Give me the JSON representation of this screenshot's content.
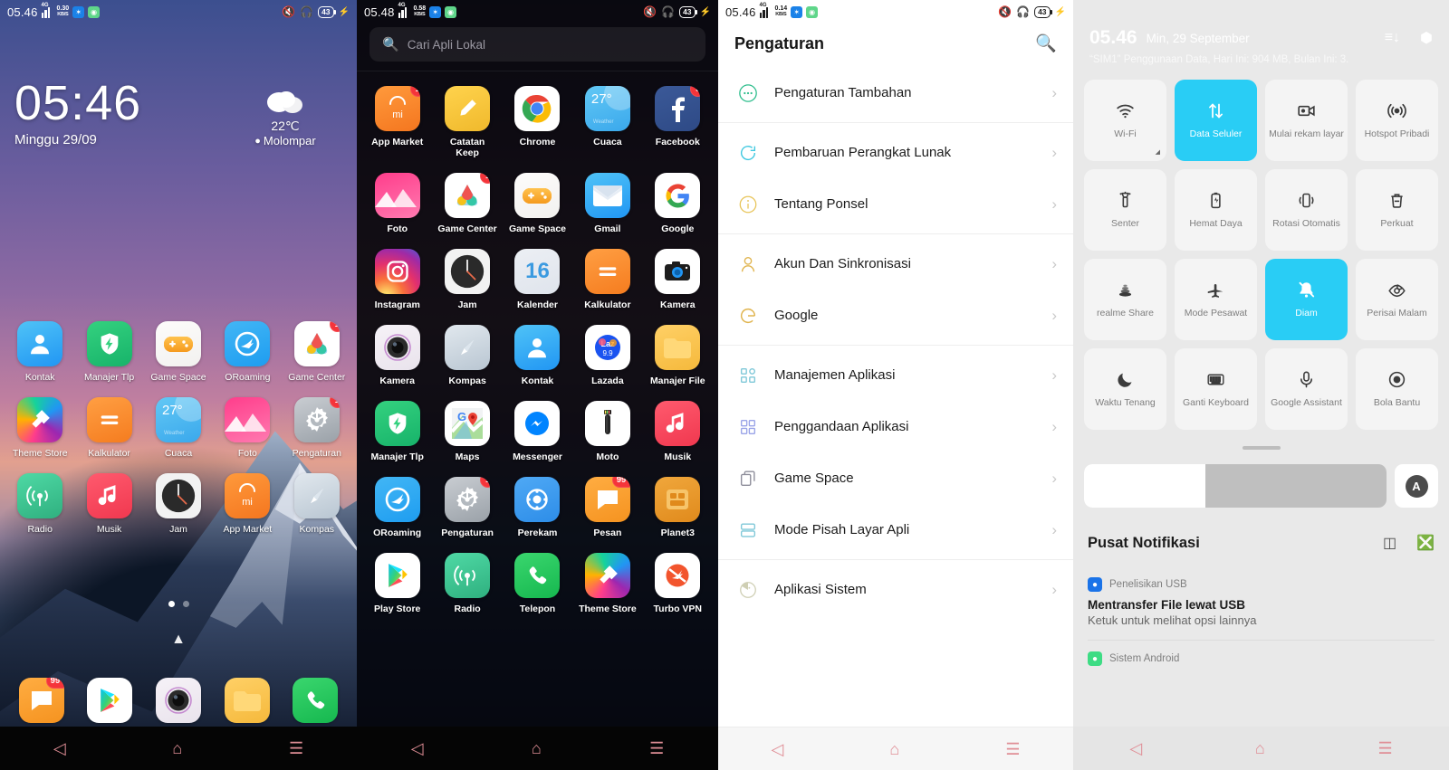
{
  "status_bar": {
    "home": {
      "time": "05.46",
      "net": "4G",
      "speed": "0.30",
      "speed_unit": "KB/S",
      "battery": "43"
    },
    "drawer": {
      "time": "05.48",
      "net": "4G",
      "speed": "0.58",
      "speed_unit": "KB/S",
      "battery": "43"
    },
    "settings": {
      "time": "05.46",
      "net": "4G",
      "speed": "0.14",
      "speed_unit": "KB/S",
      "battery": "43"
    }
  },
  "home": {
    "clock": "05:46",
    "date": "Minggu 29/09",
    "weather": {
      "temp": "22℃",
      "location": "Molompar",
      "pin": "📍"
    },
    "apps": [
      {
        "label": "Kontak",
        "icon": "contacts-icon",
        "badge": ""
      },
      {
        "label": "Manajer Tlp",
        "icon": "phone-manager-icon",
        "badge": ""
      },
      {
        "label": "Game Space",
        "icon": "game-space-icon",
        "badge": ""
      },
      {
        "label": "ORoaming",
        "icon": "oroaming-icon",
        "badge": ""
      },
      {
        "label": "Game Center",
        "icon": "game-center-icon",
        "badge": "1"
      },
      {
        "label": "Theme Store",
        "icon": "theme-store-icon",
        "badge": ""
      },
      {
        "label": "Kalkulator",
        "icon": "calculator-icon",
        "badge": ""
      },
      {
        "label": "Cuaca",
        "icon": "weather-icon",
        "badge": ""
      },
      {
        "label": "Foto",
        "icon": "photos-icon",
        "badge": ""
      },
      {
        "label": "Pengaturan",
        "icon": "settings-icon",
        "badge": "1"
      },
      {
        "label": "Radio",
        "icon": "radio-icon",
        "badge": ""
      },
      {
        "label": "Musik",
        "icon": "music-icon",
        "badge": ""
      },
      {
        "label": "Jam",
        "icon": "clock-icon",
        "badge": ""
      },
      {
        "label": "App Market",
        "icon": "app-market-icon",
        "badge": ""
      },
      {
        "label": "Kompas",
        "icon": "compass-icon",
        "badge": ""
      }
    ],
    "weather_tile_temp": "27°",
    "page_dots": {
      "count": 2,
      "active": 0
    },
    "dock": [
      {
        "label": "Pesan",
        "icon": "messages-icon",
        "badge": "99+"
      },
      {
        "label": "Play Store",
        "icon": "play-store-icon",
        "badge": ""
      },
      {
        "label": "Kamera",
        "icon": "camera-icon",
        "badge": ""
      },
      {
        "label": "Manajer File",
        "icon": "file-manager-icon",
        "badge": ""
      },
      {
        "label": "Telepon",
        "icon": "phone-icon",
        "badge": ""
      }
    ]
  },
  "drawer": {
    "search_placeholder": "Cari Apli Lokal",
    "apps": [
      {
        "label": "App Market",
        "icon": "app-market-icon",
        "badge": "1"
      },
      {
        "label": "Catatan Keep",
        "icon": "keep-notes-icon",
        "badge": ""
      },
      {
        "label": "Chrome",
        "icon": "chrome-icon",
        "badge": ""
      },
      {
        "label": "Cuaca",
        "icon": "weather-icon",
        "badge": ""
      },
      {
        "label": "Facebook",
        "icon": "facebook-icon",
        "badge": "5"
      },
      {
        "label": "Foto",
        "icon": "photos-icon",
        "badge": ""
      },
      {
        "label": "Game Center",
        "icon": "game-center-icon",
        "badge": "1"
      },
      {
        "label": "Game Space",
        "icon": "game-space-icon",
        "badge": ""
      },
      {
        "label": "Gmail",
        "icon": "gmail-icon",
        "badge": ""
      },
      {
        "label": "Google",
        "icon": "google-icon",
        "badge": ""
      },
      {
        "label": "Instagram",
        "icon": "instagram-icon",
        "badge": ""
      },
      {
        "label": "Jam",
        "icon": "clock-icon",
        "badge": ""
      },
      {
        "label": "Kalender",
        "icon": "calendar-icon",
        "badge": ""
      },
      {
        "label": "Kalkulator",
        "icon": "calculator-icon",
        "badge": ""
      },
      {
        "label": "Kamera",
        "icon": "camera-stock-icon",
        "badge": ""
      },
      {
        "label": "Kamera",
        "icon": "camera-icon",
        "badge": ""
      },
      {
        "label": "Kompas",
        "icon": "compass-icon",
        "badge": ""
      },
      {
        "label": "Kontak",
        "icon": "contacts-icon",
        "badge": ""
      },
      {
        "label": "Lazada",
        "icon": "lazada-icon",
        "badge": ""
      },
      {
        "label": "Manajer File",
        "icon": "file-manager-icon",
        "badge": ""
      },
      {
        "label": "Manajer Tlp",
        "icon": "phone-manager-icon",
        "badge": ""
      },
      {
        "label": "Maps",
        "icon": "maps-icon",
        "badge": ""
      },
      {
        "label": "Messenger",
        "icon": "messenger-icon",
        "badge": ""
      },
      {
        "label": "Moto",
        "icon": "moto-icon",
        "badge": ""
      },
      {
        "label": "Musik",
        "icon": "music-icon",
        "badge": ""
      },
      {
        "label": "ORoaming",
        "icon": "oroaming-icon",
        "badge": ""
      },
      {
        "label": "Pengaturan",
        "icon": "settings-icon",
        "badge": "1"
      },
      {
        "label": "Perekam",
        "icon": "recorder-icon",
        "badge": ""
      },
      {
        "label": "Pesan",
        "icon": "messages-icon",
        "badge": "99+"
      },
      {
        "label": "Planet3",
        "icon": "planet3-icon",
        "badge": ""
      },
      {
        "label": "Play Store",
        "icon": "play-store-icon",
        "badge": ""
      },
      {
        "label": "Radio",
        "icon": "radio-icon",
        "badge": ""
      },
      {
        "label": "Telepon",
        "icon": "phone-icon",
        "badge": ""
      },
      {
        "label": "Theme Store",
        "icon": "theme-store-icon",
        "badge": ""
      },
      {
        "label": "Turbo VPN",
        "icon": "turbo-vpn-icon",
        "badge": ""
      }
    ],
    "calendar_day": "16",
    "lazada_sale": "9.9",
    "weather_tile_temp": "27°"
  },
  "settings": {
    "title": "Pengaturan",
    "search_icon": "search-icon",
    "groups": [
      {
        "rows": [
          {
            "label": "Pengaturan Tambahan",
            "icon": "more-dots-icon",
            "color": "#2dbd8c"
          }
        ]
      },
      {
        "rows": [
          {
            "label": "Pembaruan Perangkat Lunak",
            "icon": "refresh-icon",
            "color": "#3ec8e0"
          },
          {
            "label": "Tentang Ponsel",
            "icon": "info-icon",
            "color": "#e8c55a"
          }
        ]
      },
      {
        "rows": [
          {
            "label": "Akun Dan Sinkronisasi",
            "icon": "person-icon",
            "color": "#e0b44e"
          },
          {
            "label": "Google",
            "icon": "google-g-icon",
            "color": "#e0b44e"
          }
        ]
      },
      {
        "rows": [
          {
            "label": "Manajemen Aplikasi",
            "icon": "app-grid-icon",
            "color": "#7fc8d8"
          },
          {
            "label": "Penggandaan Aplikasi",
            "icon": "clone-apps-icon",
            "color": "#9aa4e8"
          },
          {
            "label": "Game Space",
            "icon": "copy-icon",
            "color": "#8d8d9a"
          },
          {
            "label": "Mode Pisah Layar Apli",
            "icon": "split-screen-icon",
            "color": "#7fc8d8"
          }
        ]
      },
      {
        "rows": [
          {
            "label": "Aplikasi Sistem",
            "icon": "system-apps-icon",
            "color": "#cfcfb4"
          }
        ]
      }
    ]
  },
  "quick_settings": {
    "time": "05.46",
    "date": "Min, 29 September",
    "data_usage": "“SIM1” Penggunaan Data, Hari Ini: 904 MB, Bulan Ini: 3.",
    "header_icons": [
      "sort-order-icon",
      "settings-gear-icon"
    ],
    "tiles": [
      {
        "label": "Wi-Fi",
        "icon": "wifi-icon",
        "on": false,
        "corner": "expand-arrow-icon"
      },
      {
        "label": "Data Seluler",
        "icon": "data-transfer-icon",
        "on": true
      },
      {
        "label": "Mulai rekam layar",
        "icon": "screen-record-icon",
        "on": false
      },
      {
        "label": "Hotspot Pribadi",
        "icon": "hotspot-icon",
        "on": false
      },
      {
        "label": "Senter",
        "icon": "flashlight-icon",
        "on": false
      },
      {
        "label": "Hemat Daya",
        "icon": "battery-saver-icon",
        "on": false
      },
      {
        "label": "Rotasi Otomatis",
        "icon": "auto-rotate-icon",
        "on": false
      },
      {
        "label": "Perkuat",
        "icon": "boost-icon",
        "on": false
      },
      {
        "label": "realme Share",
        "icon": "realme-share-icon",
        "on": false
      },
      {
        "label": "Mode Pesawat",
        "icon": "airplane-icon",
        "on": false
      },
      {
        "label": "Diam",
        "icon": "silent-bell-icon",
        "on": true
      },
      {
        "label": "Perisai Malam",
        "icon": "night-shield-icon",
        "on": false
      },
      {
        "label": "Waktu Tenang",
        "icon": "moon-icon",
        "on": false
      },
      {
        "label": "Ganti Keyboard",
        "icon": "keyboard-icon",
        "on": false
      },
      {
        "label": "Google Assistant",
        "icon": "microphone-icon",
        "on": false
      },
      {
        "label": "Bola Bantu",
        "icon": "assistive-ball-icon",
        "on": false
      }
    ],
    "brightness": {
      "value_percent": 40,
      "auto_label": "A"
    },
    "notifications": {
      "title": "Pusat Notifikasi",
      "actions": [
        "notification-settings-icon",
        "clear-all-icon"
      ],
      "items": [
        {
          "app": "Penelisikan USB",
          "app_icon": "usb-icon",
          "app_color": "#1a73e8",
          "title": "Mentransfer File lewat USB",
          "body": "Ketuk untuk melihat opsi lainnya"
        },
        {
          "app": "Sistem Android",
          "app_icon": "android-icon",
          "app_color": "#3ddc84",
          "title": "",
          "body": ""
        }
      ]
    }
  },
  "nav_bar": {
    "back": "back-icon",
    "home": "home-icon",
    "recents": "recents-icon"
  }
}
